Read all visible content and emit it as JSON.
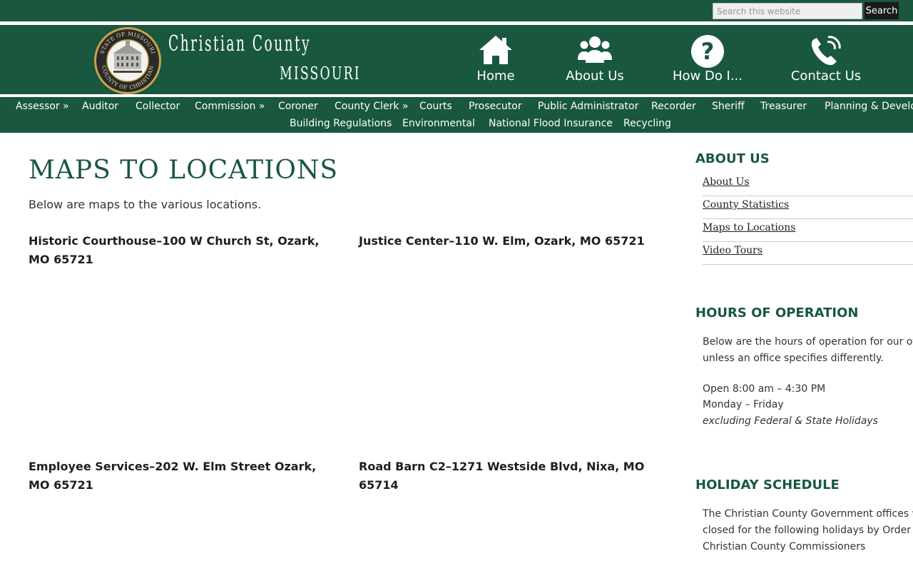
{
  "search": {
    "placeholder": "Search this website",
    "button_label": "Search"
  },
  "logo": {
    "line1": "Christian County",
    "line2": "MISSOURI",
    "seal_text": [
      "STATE OF MISSOURI",
      "COUNTY OF CHRISTIAN"
    ]
  },
  "header_nav": [
    {
      "label": "Home",
      "icon": "home-icon"
    },
    {
      "label": "About Us",
      "icon": "users-icon"
    },
    {
      "label": "How Do I...",
      "icon": "question-circle-icon"
    },
    {
      "label": "Contact Us",
      "icon": "phone-icon"
    }
  ],
  "menu": {
    "row1": [
      "Assessor »",
      "Auditor",
      "Collector",
      "Commission »",
      "Coroner",
      "County Clerk »",
      "Courts",
      "Prosecutor",
      "Public Administrator",
      "Recorder",
      "Sheriff",
      "Treasurer",
      "Planning & Development"
    ],
    "row2": [
      "Building Regulations",
      "Environmental",
      "National Flood Insurance",
      "Recycling"
    ]
  },
  "main": {
    "title": "MAPS TO LOCATIONS",
    "intro": "Below are maps to the various locations.",
    "locations": [
      "Historic Courthouse–100 W Church St, Ozark, MO 65721",
      "Justice Center–110 W. Elm, Ozark, MO 65721",
      "Employee Services–202 W. Elm Street Ozark, MO 65721",
      "Road Barn C2–1271 Westside Blvd, Nixa, MO 65714"
    ]
  },
  "sidebar": {
    "about_heading": "ABOUT US",
    "about_links": [
      "About Us",
      "County Statistics",
      "Maps to Locations",
      "Video Tours"
    ],
    "hours_heading": "HOURS OF OPERATION",
    "hours_line1": "Below are the hours of operation for our offices",
    "hours_line2": "unless an office specifies differently.",
    "hours_open": "Open 8:00 am – 4:30 PM",
    "hours_days": "Monday – Friday",
    "hours_excl": "excluding Federal & State Holidays",
    "holiday_heading": "HOLIDAY SCHEDULE",
    "holiday_line1": "The Christian County Government offices will be",
    "holiday_line2": "closed for the following holidays by Order of the",
    "holiday_line3": "Christian County Commissioners"
  },
  "colors": {
    "brand_green": "#19573f",
    "search_button": "#1a1a1a"
  }
}
